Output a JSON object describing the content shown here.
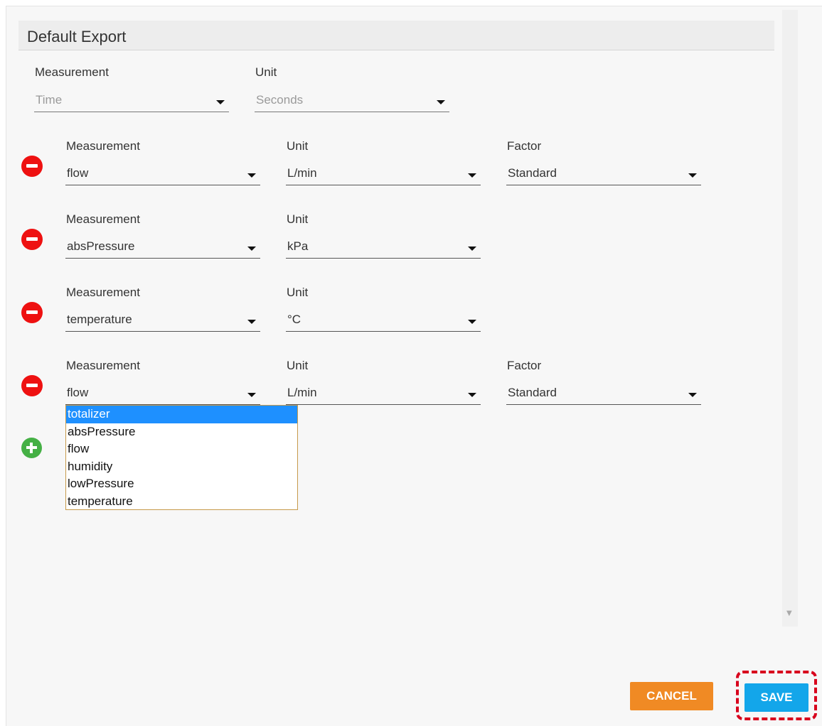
{
  "header": {
    "title": "Default Export"
  },
  "default_row": {
    "measurement_label": "Measurement",
    "unit_label": "Unit",
    "measurement_value": "Time",
    "unit_value": "Seconds"
  },
  "rows": [
    {
      "measurement_label": "Measurement",
      "unit_label": "Unit",
      "factor_label": "Factor",
      "measurement_value": "flow",
      "unit_value": "L/min",
      "factor_value": "Standard"
    },
    {
      "measurement_label": "Measurement",
      "unit_label": "Unit",
      "measurement_value": "absPressure",
      "unit_value": "kPa"
    },
    {
      "measurement_label": "Measurement",
      "unit_label": "Unit",
      "measurement_value": "temperature",
      "unit_value": "°C"
    },
    {
      "measurement_label": "Measurement",
      "unit_label": "Unit",
      "factor_label": "Factor",
      "measurement_value": "flow",
      "unit_value": "L/min",
      "factor_value": "Standard"
    }
  ],
  "dropdown": {
    "options": [
      "totalizer",
      "absPressure",
      "flow",
      "humidity",
      "lowPressure",
      "temperature"
    ],
    "highlighted": "totalizer"
  },
  "icons": {
    "remove": "minus-circle-icon",
    "add": "plus-circle-icon",
    "caret": "caret-down-icon"
  },
  "buttons": {
    "cancel": "CANCEL",
    "save": "SAVE"
  },
  "colors": {
    "remove": "#ee1111",
    "add": "#45b045",
    "cancel": "#f08a24",
    "save": "#13a6ea",
    "highlight_box": "#d8001c",
    "dropdown_selected": "#1e90ff"
  }
}
